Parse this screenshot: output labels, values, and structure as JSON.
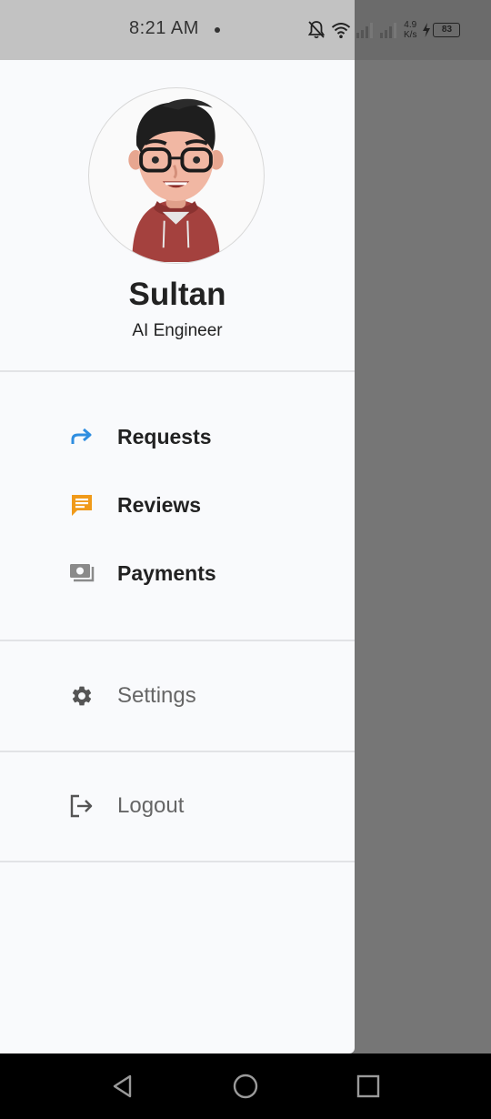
{
  "status_bar": {
    "time": "8:21 AM",
    "net_speed_value": "4.9",
    "net_speed_unit": "K/s",
    "battery_level": "83",
    "icons": [
      "notifications-off-icon",
      "wifi-icon",
      "signal-icon",
      "signal-icon",
      "charging-icon",
      "battery-icon"
    ]
  },
  "profile": {
    "name": "Sultan",
    "role": "AI Engineer",
    "avatar": "avatar-image"
  },
  "menu": {
    "primary": [
      {
        "label": "Requests",
        "icon": "redo-arrow-icon",
        "color": "#2f8ee0"
      },
      {
        "label": "Reviews",
        "icon": "chat-message-icon",
        "color": "#f09a1a"
      },
      {
        "label": "Payments",
        "icon": "payments-icon",
        "color": "#8a8a8a"
      }
    ],
    "settings": {
      "label": "Settings",
      "icon": "gear-icon"
    },
    "logout": {
      "label": "Logout",
      "icon": "logout-icon"
    }
  },
  "navigation_bar": {
    "icons": [
      "back-icon",
      "home-icon",
      "recents-icon"
    ]
  },
  "colors": {
    "drawer_background": "#f9fafc",
    "scrim": "#767676",
    "text_primary": "#222222",
    "text_secondary": "#666666"
  }
}
